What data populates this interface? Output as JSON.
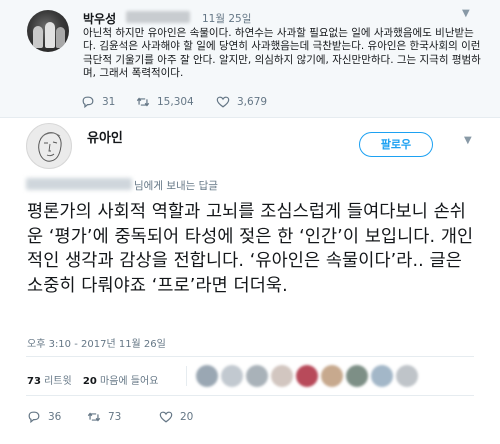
{
  "parent_tweet": {
    "author_name": "박우성",
    "date": "11월 25일",
    "body": "아닌척 하지만 유아인은 속물이다. 하연수는 사과할 필요없는 일에 사과했음에도 비난받는다. 김윤석은 사과해야 할 일에 당연히 사과했음는데 극찬받는다. 유아인은 한국사회의 이런 극단적 기울기를 아주 잘 안다. 알지만, 의심하지 않기에, 자신만만하다. 그는 지극히 평범하며, 그래서 폭력적이다.",
    "replies": "31",
    "retweets": "15,304",
    "likes": "3,679"
  },
  "main_tweet": {
    "author_name": "유아인",
    "follow_label": "팔로우",
    "reply_to_suffix": "님에게 보내는 답글",
    "text": "평론가의 사회적 역할과 고뇌를 조심스럽게 들여다보니 손쉬운 ‘평가’에 중독되어 타성에 젖은 한 ‘인간’이 보입니다. 개인적인 생각과 감상을 전합니다. ‘유아인은 속물이다’라.. 글은 소중히 다뤄야죠 ‘프로’라면 더더욱.",
    "timestamp": "오후 3:10 - 2017년 11월 26일",
    "retweet_count": "73",
    "retweet_label": "리트윗",
    "like_count": "20",
    "like_label": "마음에 들어요",
    "replies": "36",
    "retweets": "73",
    "likes": "20"
  },
  "icons": {
    "reply": "reply-icon",
    "retweet": "retweet-icon",
    "like": "heart-icon",
    "more": "chevron-down-icon"
  },
  "colors": {
    "accent": "#1da1f2",
    "muted": "#657786",
    "parent_bg": "#f5f8fa"
  }
}
